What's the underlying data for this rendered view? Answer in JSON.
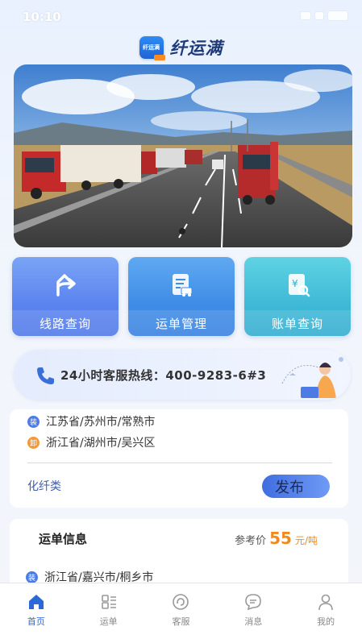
{
  "status": {
    "time": "10:10"
  },
  "app": {
    "title": "纤运满",
    "logo_text": "纤运满"
  },
  "quick_actions": [
    {
      "label": "线路查询",
      "icon": "route-arrow-icon"
    },
    {
      "label": "运单管理",
      "icon": "waybill-truck-icon"
    },
    {
      "label": "账单查询",
      "icon": "bill-search-icon"
    }
  ],
  "hotline": {
    "text": "24小时客服热线：400-9283-6#3"
  },
  "order_card": {
    "load_badge": "装",
    "unload_badge": "卸",
    "load_address": "江苏省/苏州市/常熟市",
    "unload_address": "浙江省/湖州市/吴兴区",
    "cargo_type": "化纤类",
    "publish_label": "发布"
  },
  "waybill_card": {
    "title": "运单信息",
    "ref_label": "参考价",
    "ref_value": "55",
    "ref_unit": "元/吨",
    "load_badge": "装",
    "load_address": "浙江省/嘉兴市/桐乡市"
  },
  "tabs": [
    {
      "label": "首页",
      "icon": "home-icon",
      "active": true
    },
    {
      "label": "运单",
      "icon": "list-icon",
      "active": false
    },
    {
      "label": "客服",
      "icon": "headset-icon",
      "active": false
    },
    {
      "label": "消息",
      "icon": "chat-icon",
      "active": false
    },
    {
      "label": "我的",
      "icon": "user-icon",
      "active": false
    }
  ],
  "colors": {
    "accent": "#2b6ad6",
    "price": "#f08a1c",
    "load": "#4d7be6",
    "unload": "#f29a3a"
  }
}
